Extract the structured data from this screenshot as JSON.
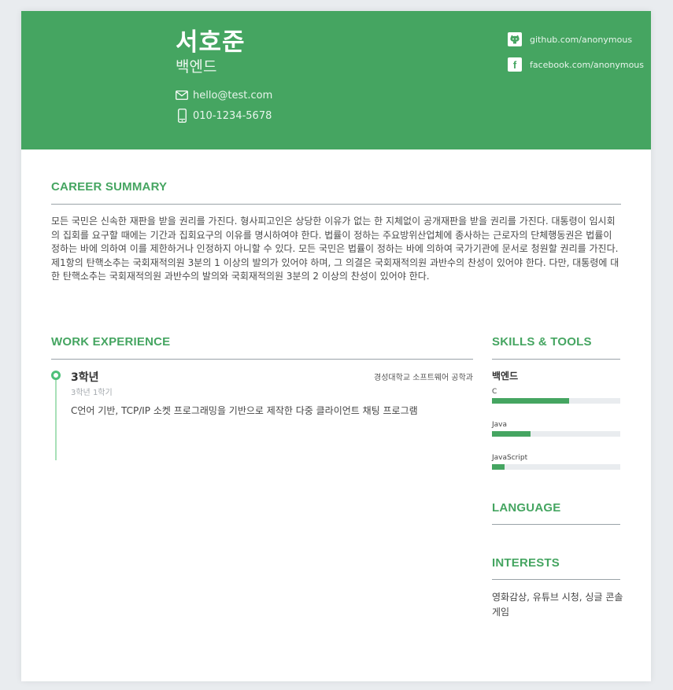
{
  "profile": {
    "name": "서호준",
    "role": "백엔드",
    "email": "hello@test.com",
    "phone": "010-1234-5678",
    "github": "github.com/anonymous",
    "facebook": "facebook.com/anonymous"
  },
  "sections": {
    "summary_title": "CAREER SUMMARY",
    "work_title": "WORK EXPERIENCE",
    "skills_title": "SKILLS & TOOLS",
    "language_title": "LANGUAGE",
    "interests_title": "INTERESTS"
  },
  "summary": "모든 국민은 신속한 재판을 받을 권리를 가진다. 형사피고인은 상당한 이유가 없는 한 지체없이 공개재판을 받을 권리를 가진다. 대통령이 임시회의 집회를 요구할 때에는 기간과 집회요구의 이유를 명시하여야 한다. 법률이 정하는 주요방위산업체에 종사하는 근로자의 단체행동권은 법률이 정하는 바에 의하여 이를 제한하거나 인정하지 아니할 수 있다. 모든 국민은 법률이 정하는 바에 의하여 국가기관에 문서로 청원할 권리를 가진다. 제1항의 탄핵소추는 국회재적의원 3분의 1 이상의 발의가 있어야 하며, 그 의결은 국회재적의원 과반수의 찬성이 있어야 한다. 다만, 대통령에 대한 탄핵소추는 국회재적의원 과반수의 발의와 국회재적의원 3분의 2 이상의 찬성이 있어야 한다.",
  "work": [
    {
      "title": "3학년",
      "period": "3학년 1학기",
      "org": "경성대학교 소프트웨어 공학과",
      "description": "C언어 기반, TCP/IP 소켓 프로그래밍을 기반으로 제작한 다중 클라이언트 채팅 프로그램"
    }
  ],
  "skills": {
    "group": "백엔드",
    "items": [
      {
        "name": "C",
        "level": 0.6
      },
      {
        "name": "Java",
        "level": 0.3
      },
      {
        "name": "JavaScript",
        "level": 0.1
      }
    ]
  },
  "interests": "영화감상, 유튜브 시청, 싱글 콘솔게임",
  "colors": {
    "brand": "#45a561",
    "timeline": "#4ec07a"
  }
}
